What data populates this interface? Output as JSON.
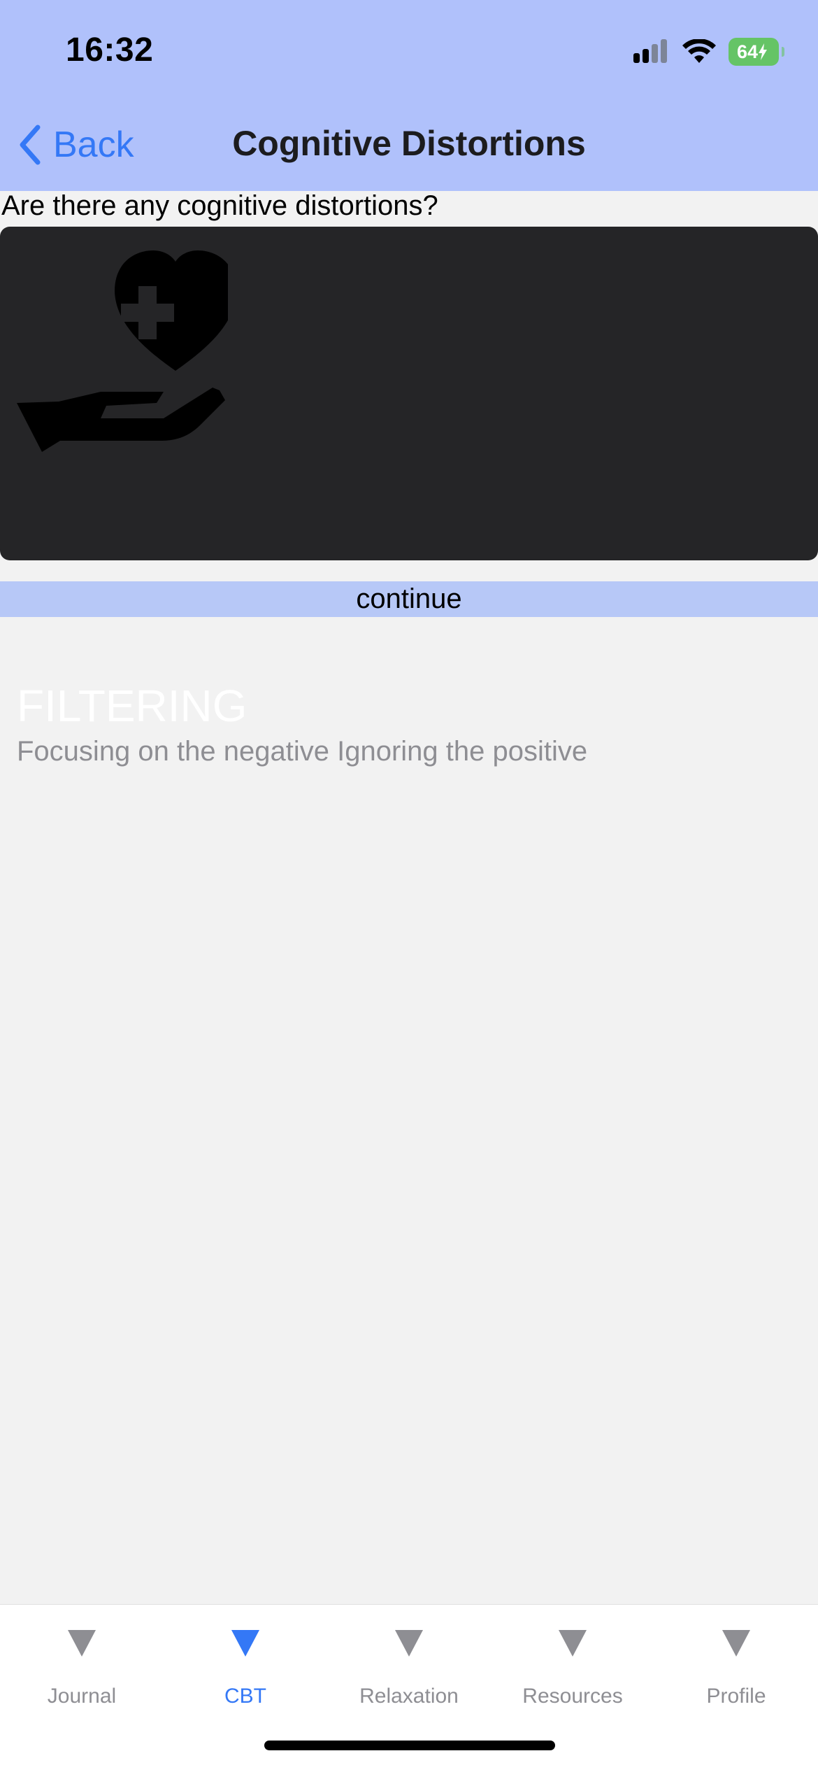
{
  "status_bar": {
    "time": "16:32",
    "battery": "64"
  },
  "nav": {
    "back_label": "Back",
    "title": "Cognitive Distortions"
  },
  "content": {
    "question": "Are there any cognitive distortions?",
    "card": {
      "title": "FILTERING",
      "subtitle": "Focusing on the negative Ignoring the positive",
      "icon": "hand-heart-icon"
    },
    "continue_label": "continue"
  },
  "tabbar": {
    "tabs": [
      {
        "label": "Journal",
        "active": false
      },
      {
        "label": "CBT",
        "active": true
      },
      {
        "label": "Relaxation",
        "active": false
      },
      {
        "label": "Resources",
        "active": false
      },
      {
        "label": "Profile",
        "active": false
      }
    ]
  },
  "colors": {
    "header_bg": "#b0c1fb",
    "accent": "#3478f6",
    "card_bg": "#252527",
    "continue_bg": "#b7c8f7",
    "battery": "#65c466"
  }
}
